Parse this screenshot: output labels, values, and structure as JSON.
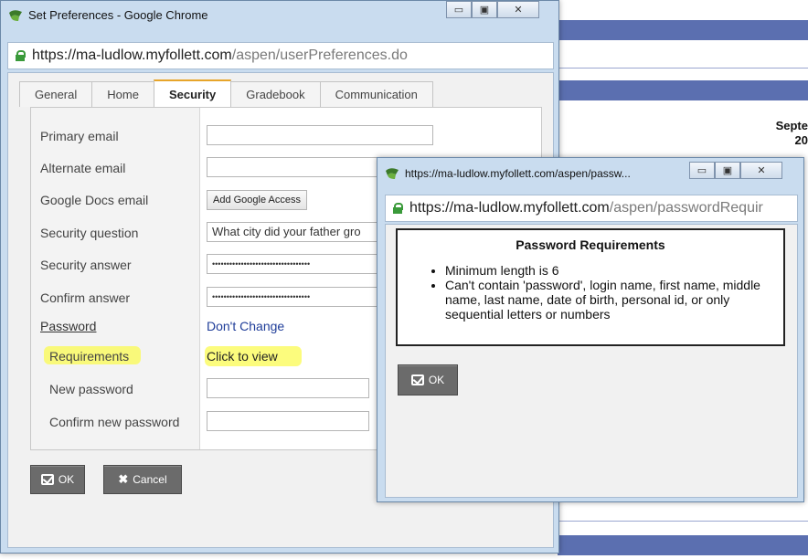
{
  "background": {
    "date_text_line1": "Septe",
    "date_text_line2": "20"
  },
  "main_window": {
    "title": "Set Preferences - Google Chrome",
    "url_host": "https://ma-ludlow.myfollett.com",
    "url_path": "/aspen/userPreferences.do",
    "tabs": [
      {
        "label": "General"
      },
      {
        "label": "Home"
      },
      {
        "label": "Security"
      },
      {
        "label": "Gradebook"
      },
      {
        "label": "Communication"
      }
    ],
    "active_tab": "Security",
    "fields": {
      "primary_email_label": "Primary email",
      "primary_email_value": "",
      "alternate_email_label": "Alternate email",
      "alternate_email_value": "",
      "google_docs_label": "Google Docs email",
      "google_docs_button": "Add Google Access",
      "security_question_label": "Security question",
      "security_question_value": "What city did your father gro",
      "security_answer_label": "Security answer",
      "security_answer_value": "••••••••••••••••••••••••••••••••••",
      "confirm_answer_label": "Confirm answer",
      "confirm_answer_value": "••••••••••••••••••••••••••••••••••",
      "password_label": "Password",
      "password_link": "Don't Change",
      "requirements_label": "Requirements",
      "requirements_link": "Click to view",
      "new_password_label": "New password",
      "new_password_value": "",
      "confirm_new_password_label": "Confirm new password",
      "confirm_new_password_value": ""
    },
    "ok_button": "OK",
    "cancel_button": "Cancel",
    "highlight_color": "#fbfb52"
  },
  "popup_window": {
    "title": "https://ma-ludlow.myfollett.com/aspen/passw...",
    "url_host": "https://ma-ludlow.myfollett.com",
    "url_path": "/aspen/passwordRequir",
    "heading": "Password Requirements",
    "requirements": [
      "Minimum length is 6",
      "Can't contain 'password', login name, first name, middle name, last name, date of birth, personal id, or only sequential letters or numbers"
    ],
    "ok_button": "OK"
  }
}
